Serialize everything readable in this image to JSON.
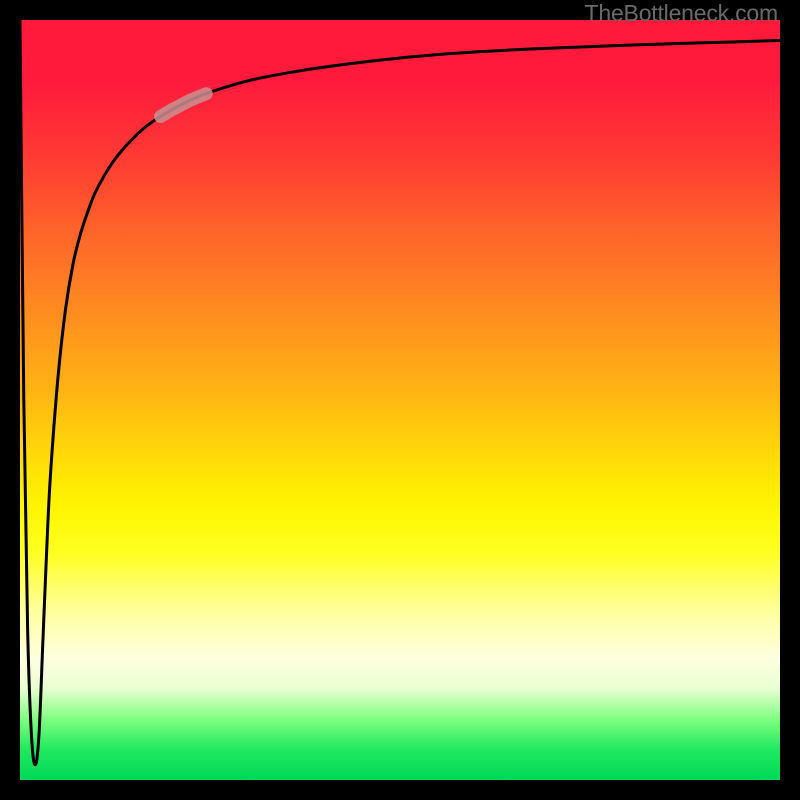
{
  "watermark": "TheBottleneck.com",
  "chart_data": {
    "type": "line",
    "title": "",
    "xlabel": "",
    "ylabel": "",
    "xlim": [
      0,
      100
    ],
    "ylim": [
      0,
      100
    ],
    "grid": false,
    "legend": false,
    "background_gradient": {
      "direction": "vertical",
      "stops": [
        {
          "pos": 0,
          "color": "#ff1a3c"
        },
        {
          "pos": 50,
          "color": "#ffd400"
        },
        {
          "pos": 80,
          "color": "#ffffc0"
        },
        {
          "pos": 100,
          "color": "#00d858"
        }
      ]
    },
    "series": [
      {
        "name": "main-curve",
        "color": "#000000",
        "x": [
          0.0,
          0.5,
          1.0,
          1.5,
          2.0,
          2.5,
          3.0,
          3.5,
          4.0,
          5.0,
          6.0,
          7.0,
          8.0,
          9.0,
          10.0,
          12.0,
          14.0,
          16.0,
          18.0,
          20.0,
          22.5,
          25.0,
          30.0,
          35.0,
          40.0,
          50.0,
          60.0,
          70.0,
          80.0,
          90.0,
          100.0
        ],
        "y": [
          100.0,
          50.0,
          20.0,
          6.0,
          2.0,
          6.0,
          18.0,
          30.0,
          40.0,
          53.0,
          62.0,
          68.0,
          72.0,
          75.0,
          77.5,
          81.0,
          83.5,
          85.5,
          87.0,
          88.2,
          89.5,
          90.5,
          92.0,
          93.0,
          93.8,
          95.0,
          95.8,
          96.3,
          96.7,
          97.0,
          97.3
        ]
      }
    ],
    "highlight_segment": {
      "color": "#c99090",
      "x_range": [
        18.5,
        24.5
      ],
      "note": "semi-transparent pink segment on curve"
    }
  }
}
